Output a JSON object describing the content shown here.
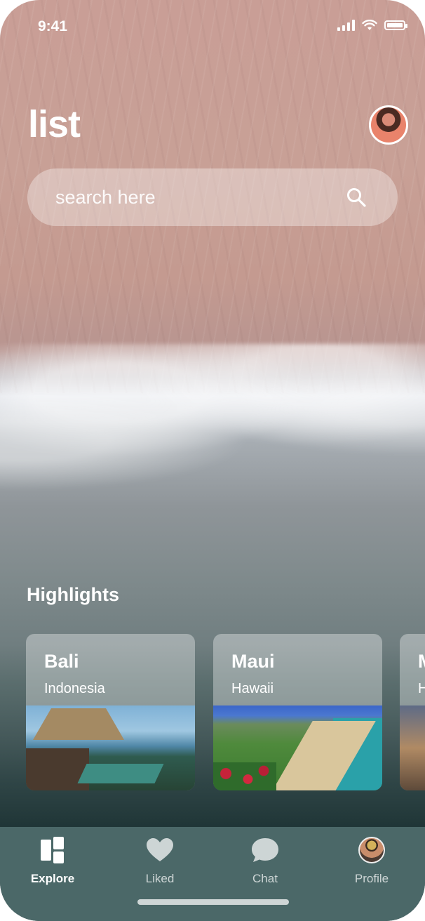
{
  "status_bar": {
    "time": "9:41"
  },
  "header": {
    "title": "list"
  },
  "search": {
    "placeholder": "search here"
  },
  "highlights": {
    "title": "Highlights",
    "cards": [
      {
        "title": "Bali",
        "subtitle": "Indonesia"
      },
      {
        "title": "Maui",
        "subtitle": "Hawaii"
      },
      {
        "title": "M",
        "subtitle": "H"
      }
    ]
  },
  "tab_bar": {
    "items": [
      {
        "label": "Explore",
        "icon": "explore-icon",
        "active": true
      },
      {
        "label": "Liked",
        "icon": "heart-icon",
        "active": false
      },
      {
        "label": "Chat",
        "icon": "chat-icon",
        "active": false
      },
      {
        "label": "Profile",
        "icon": "profile-avatar",
        "active": false
      }
    ]
  },
  "colors": {
    "tab_bar_bg": "#4b6868",
    "card_overlay": "rgba(255,255,255,0.35)"
  }
}
